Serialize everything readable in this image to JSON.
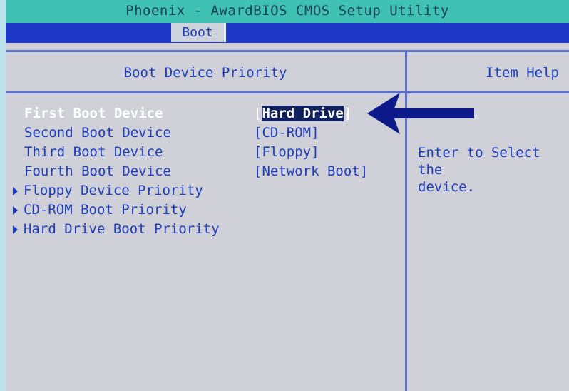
{
  "window": {
    "title": "Phoenix - AwardBIOS CMOS Setup Utility"
  },
  "tabs": [
    {
      "label": "Boot",
      "active": true
    }
  ],
  "main": {
    "header": "Boot Device Priority",
    "items": [
      {
        "label": "First Boot Device",
        "value_prefix": "[",
        "value_text": "Hard Drive",
        "value_suffix": "]",
        "selected": true
      },
      {
        "label": "Second Boot Device",
        "value": "[CD-ROM]"
      },
      {
        "label": "Third Boot Device",
        "value": "[Floppy]"
      },
      {
        "label": "Fourth Boot Device",
        "value": "[Network Boot]"
      }
    ],
    "submenus": [
      {
        "label": "Floppy Device Priority"
      },
      {
        "label": "CD-ROM Boot Priority"
      },
      {
        "label": "Hard Drive Boot Priority"
      }
    ]
  },
  "help": {
    "header": "Item Help",
    "line1": "Enter to Select the",
    "line2": "device."
  },
  "colors": {
    "title_bar": "#3fc1b4",
    "tab_bar": "#2038c8",
    "text_blue": "#1d3cb8",
    "background": "#cfd0d8",
    "arrow": "#0c1a8a"
  },
  "annotation": {
    "arrow_icon": "left-arrow-icon"
  }
}
